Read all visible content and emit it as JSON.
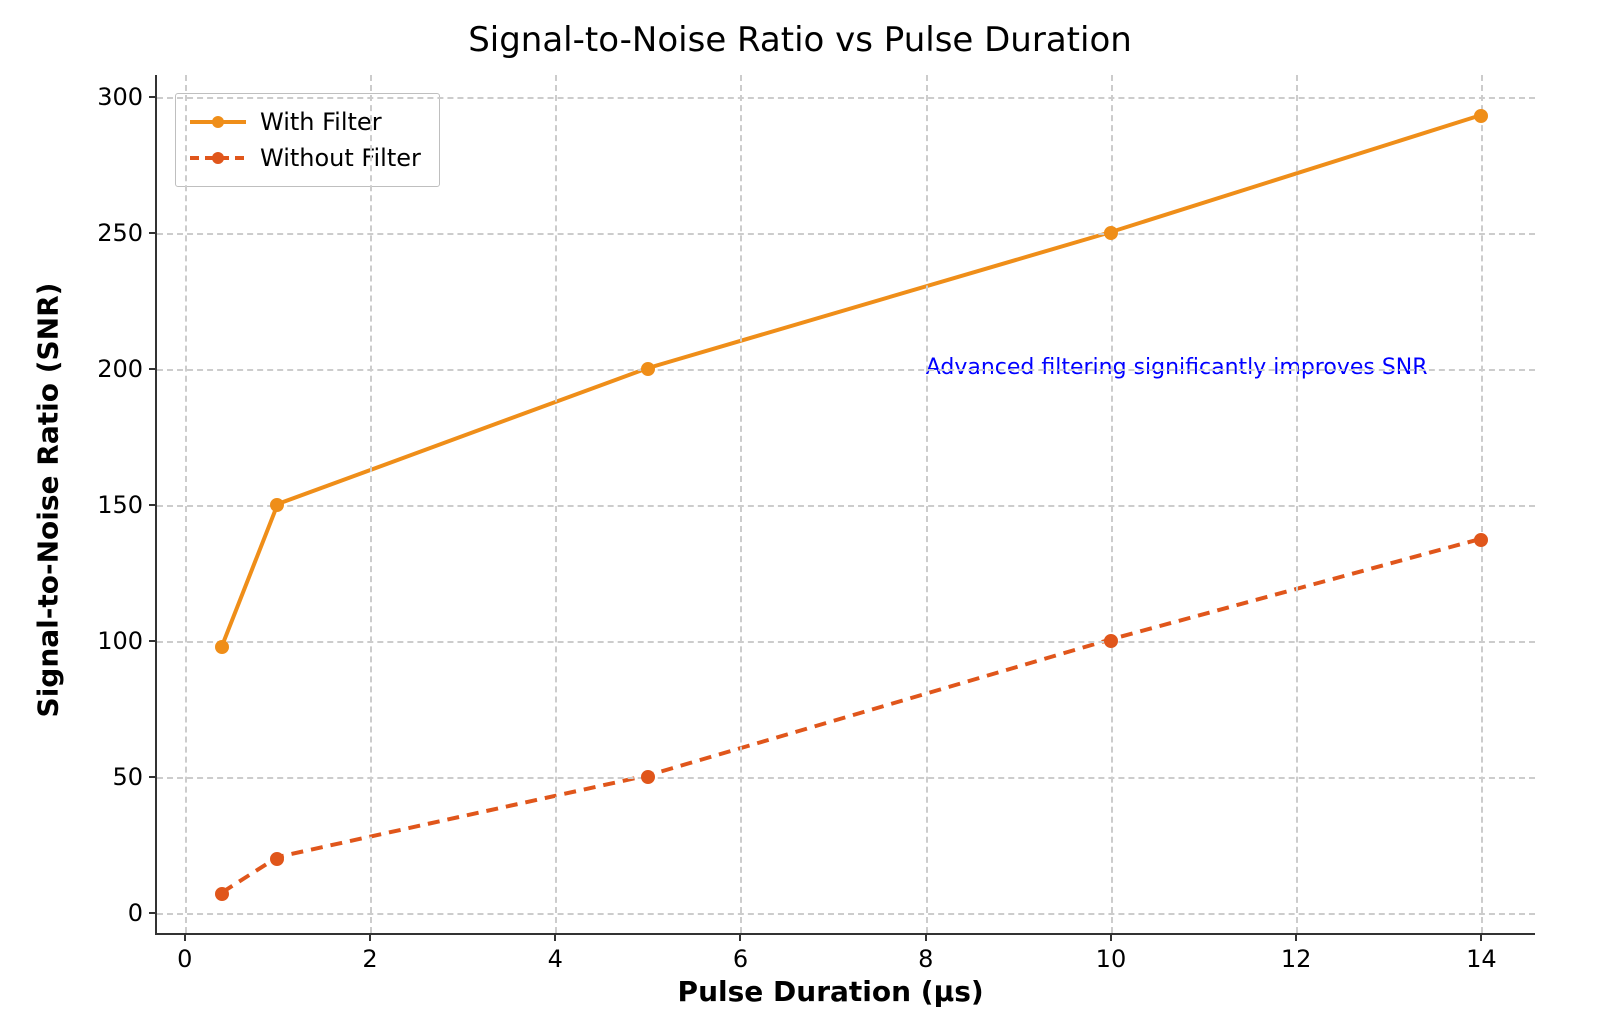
{
  "chart_data": {
    "type": "line",
    "title": "Signal-to-Noise Ratio vs Pulse Duration",
    "xlabel": "Pulse Duration (μs)",
    "ylabel": "Signal-to-Noise Ratio (SNR)",
    "x_ticks": [
      0,
      2,
      4,
      6,
      8,
      10,
      12,
      14
    ],
    "y_ticks": [
      0,
      50,
      100,
      150,
      200,
      250,
      300
    ],
    "xlim": [
      -0.3,
      14.6
    ],
    "ylim": [
      -8,
      308
    ],
    "grid": true,
    "legend_position": "upper-left",
    "annotation": {
      "text": "Advanced filtering significantly improves SNR",
      "x": 8.0,
      "y": 200,
      "color": "blue"
    },
    "series": [
      {
        "name": "With Filter",
        "color": "#ef8e19",
        "style": "solid",
        "x": [
          0.4,
          1,
          5,
          10,
          14
        ],
        "y": [
          98,
          150,
          200,
          250,
          293
        ]
      },
      {
        "name": "Without Filter",
        "color": "#e0561b",
        "style": "dashed",
        "x": [
          0.4,
          1,
          5,
          10,
          14
        ],
        "y": [
          7,
          20,
          50,
          100,
          137
        ]
      }
    ]
  }
}
